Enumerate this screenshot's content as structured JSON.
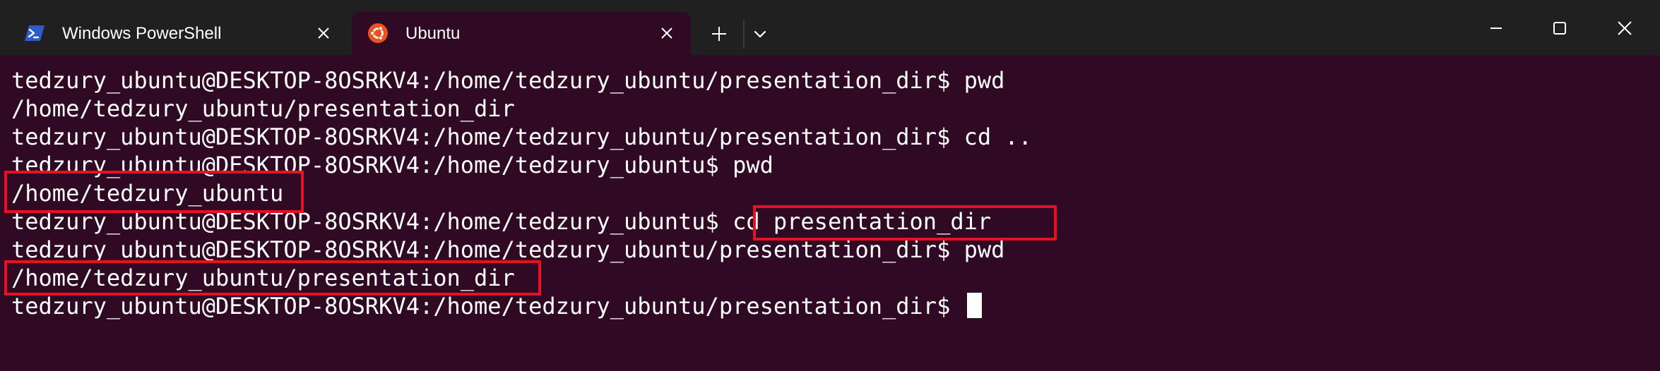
{
  "tabs": [
    {
      "title": "Windows PowerShell",
      "icon": "powershell-icon",
      "active": false
    },
    {
      "title": "Ubuntu",
      "icon": "ubuntu-icon",
      "active": true
    }
  ],
  "toolbar": {
    "new_tab_icon": "plus-icon",
    "dropdown_icon": "chevron-down-icon"
  },
  "window_controls": [
    "minimize-icon",
    "maximize-icon",
    "close-icon"
  ],
  "terminal": {
    "lines": [
      {
        "prompt": "tedzury_ubuntu@DESKTOP-8OSRKV4:/home/tedzury_ubuntu/presentation_dir$ ",
        "command": "pwd"
      },
      {
        "output": "/home/tedzury_ubuntu/presentation_dir"
      },
      {
        "prompt": "tedzury_ubuntu@DESKTOP-8OSRKV4:/home/tedzury_ubuntu/presentation_dir$ ",
        "command": "cd .."
      },
      {
        "prompt": "tedzury_ubuntu@DESKTOP-8OSRKV4:/home/tedzury_ubuntu$ ",
        "command": "pwd"
      },
      {
        "output": "/home/tedzury_ubuntu"
      },
      {
        "prompt": "tedzury_ubuntu@DESKTOP-8OSRKV4:/home/tedzury_ubuntu$ ",
        "command": "cd presentation_dir"
      },
      {
        "prompt": "tedzury_ubuntu@DESKTOP-8OSRKV4:/home/tedzury_ubuntu/presentation_dir$ ",
        "command": "pwd"
      },
      {
        "output": "/home/tedzury_ubuntu/presentation_dir"
      },
      {
        "prompt": "tedzury_ubuntu@DESKTOP-8OSRKV4:/home/tedzury_ubuntu/presentation_dir$ ",
        "command": ""
      }
    ]
  },
  "colors": {
    "terminal_bg": "#300a24",
    "titlebar_bg": "#202020",
    "text": "#ffffff",
    "highlight": "#e81123",
    "ubuntu_orange": "#e95420",
    "powershell_blue": "#2d5cc9"
  }
}
